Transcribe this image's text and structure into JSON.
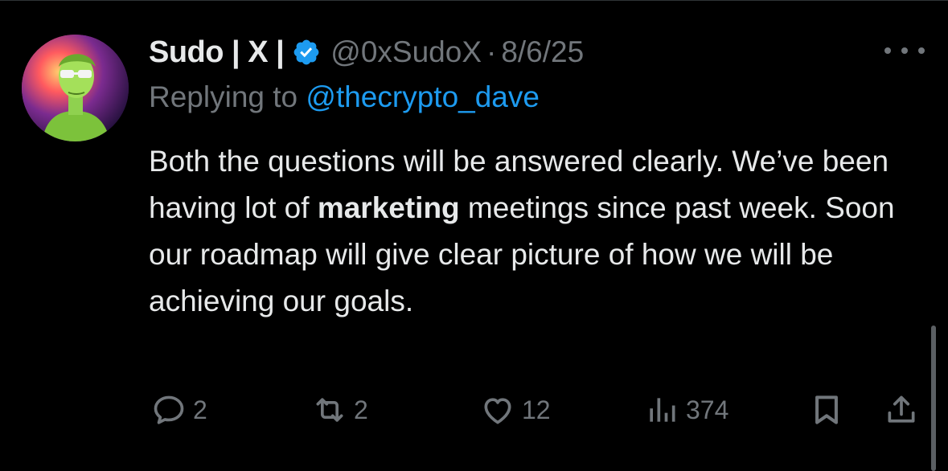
{
  "tweet": {
    "display_name": "Sudo | X |",
    "handle": "@0xSudoX",
    "separator": "·",
    "timestamp": "8/6/25",
    "replying_prefix": "Replying to",
    "replying_to": "@thecrypto_dave",
    "body_before": "Both the questions will be answered clearly. We’ve been having lot of ",
    "body_bold": "marketing",
    "body_after": " meetings since past week. Soon our roadmap will give clear picture of how we will be achieving our goals."
  },
  "actions": {
    "replies": "2",
    "reposts": "2",
    "likes": "12",
    "views": "374"
  },
  "icons": {
    "verified": "verified-badge-icon",
    "more": "more-icon",
    "reply": "reply-icon",
    "repost": "repost-icon",
    "like": "heart-icon",
    "views": "views-icon",
    "bookmark": "bookmark-icon",
    "share": "share-icon"
  },
  "colors": {
    "background": "#000000",
    "primary_text": "#e7e9ea",
    "secondary_text": "#71767b",
    "link": "#1d9bf0",
    "verified": "#1d9bf0"
  }
}
